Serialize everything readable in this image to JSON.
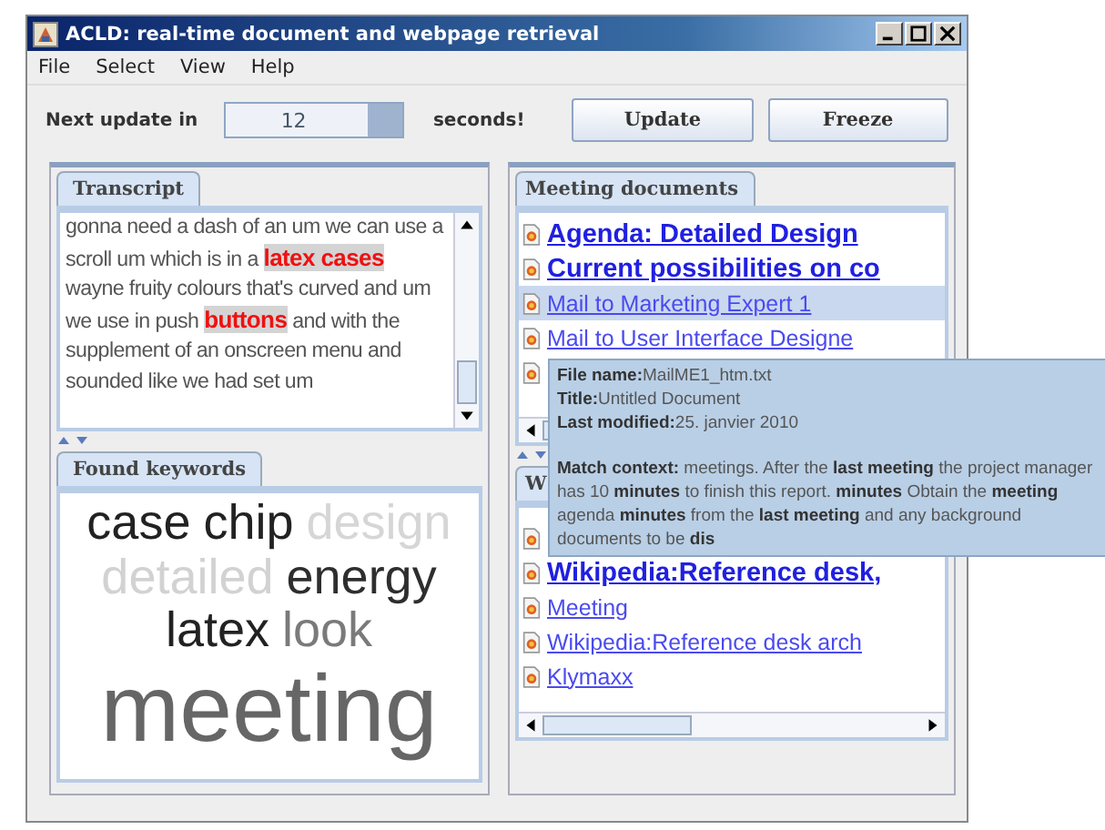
{
  "window": {
    "title": "ACLD: real-time document and webpage retrieval"
  },
  "menu": [
    "File",
    "Select",
    "View",
    "Help"
  ],
  "toolbar": {
    "label": "Next update in",
    "timer": {
      "value": "12",
      "level": 0.2
    },
    "suffix": "seconds!",
    "buttons": [
      "Update",
      "Freeze"
    ]
  },
  "transcript": {
    "tab": {
      "label": "Transcript",
      "selected": true
    },
    "segments": [
      {
        "text": "gonna need a dash of an um we can use a scroll um which is in a",
        "highlighted": false
      },
      {
        "text": "latex cases",
        "highlighted": true
      },
      {
        "text": "wayne fruity colours that's curved and um we use in push",
        "highlighted": false
      },
      {
        "text": "buttons",
        "highlighted": true
      },
      {
        "text": "and with the supplement of an onscreen menu and sounded like we had set um",
        "highlighted": false
      }
    ]
  },
  "keywords": {
    "tab": {
      "label": "Found keywords",
      "selected": true
    },
    "words": [
      {
        "text": "case",
        "kind": "normal",
        "color": "#222222"
      },
      {
        "text": "chip",
        "kind": "normal",
        "color": "#222222"
      },
      {
        "text": "design",
        "kind": "normal",
        "color": "#d6d6d6"
      },
      {
        "text": "detailed",
        "kind": "normal",
        "color": "#d2d2d2"
      },
      {
        "text": "energy",
        "kind": "normal",
        "color": "#2e2e2e"
      },
      {
        "text": "latex",
        "kind": "normal",
        "color": "#222222"
      },
      {
        "text": "look",
        "kind": "normal",
        "color": "#7a7a7a"
      },
      {
        "text": "meeting",
        "kind": "large",
        "color": "#666666"
      }
    ]
  },
  "meeting_documents": {
    "tab": {
      "label": "Meeting documents",
      "selected": true
    },
    "items": [
      {
        "title": "Agenda: Detailed Design",
        "emphasis": true,
        "selected": false
      },
      {
        "title": "Current possibilities on co",
        "emphasis": true,
        "selected": false
      },
      {
        "title": "Mail to Marketing Expert 1",
        "emphasis": false,
        "selected": true
      },
      {
        "title": "Mail to User Interface Designe",
        "emphasis": false,
        "selected": false
      },
      {
        "selected": false
      }
    ]
  },
  "web_documents": {
    "tab": {
      "label": "W",
      "selected": true
    },
    "items": [
      {
        "selected": false
      },
      {
        "title": "Wikipedia:Reference desk,",
        "emphasis": true,
        "selected": false
      },
      {
        "title": "Meeting ",
        "emphasis": false,
        "selected": false
      },
      {
        "title": "Wikipedia:Reference desk arch",
        "emphasis": false,
        "selected": false
      },
      {
        "title": "Klymaxx ",
        "emphasis": false,
        "selected": false
      }
    ]
  },
  "tooltip": {
    "lines": [
      "**File name:**MailME1_htm.txt",
      "**Title:**Untitled Document",
      "**Last modified:**25. janvier 2010"
    ],
    "context": "**Match context:** meetings. After the **last meeting** the project manager has 10 **minutes** to finish this report. **minutes** Obtain the **meeting** agenda **minutes** from the **last meeting** and any background documents to be **dis**"
  }
}
